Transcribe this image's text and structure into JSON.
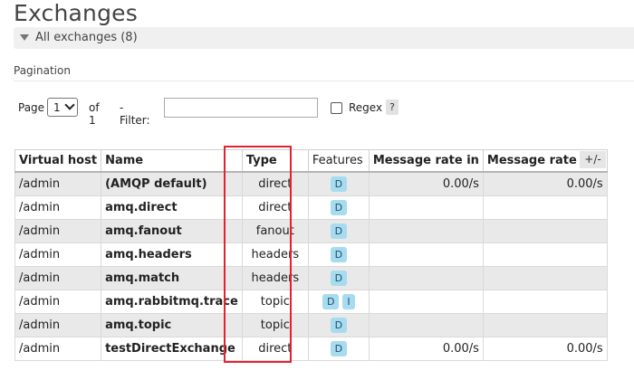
{
  "page": {
    "title": "Exchanges",
    "section_toggle_label": "All exchanges (8)"
  },
  "pagination": {
    "label": "Pagination",
    "page_label": "Page",
    "page_value": "1",
    "of_label": "of 1",
    "filter_label": "- Filter:",
    "filter_value": "",
    "regex_label": "Regex",
    "help_label": "?"
  },
  "table": {
    "columns": [
      "Virtual host",
      "Name",
      "Type",
      "Features",
      "Message rate in",
      "Message rate out"
    ],
    "toggle_columns_label": "+/-",
    "rows": [
      {
        "vhost": "/admin",
        "name": "(AMQP default)",
        "type": "direct",
        "features": [
          "D"
        ],
        "rate_in": "0.00/s",
        "rate_out": "0.00/s"
      },
      {
        "vhost": "/admin",
        "name": "amq.direct",
        "type": "direct",
        "features": [
          "D"
        ],
        "rate_in": "",
        "rate_out": ""
      },
      {
        "vhost": "/admin",
        "name": "amq.fanout",
        "type": "fanout",
        "features": [
          "D"
        ],
        "rate_in": "",
        "rate_out": ""
      },
      {
        "vhost": "/admin",
        "name": "amq.headers",
        "type": "headers",
        "features": [
          "D"
        ],
        "rate_in": "",
        "rate_out": ""
      },
      {
        "vhost": "/admin",
        "name": "amq.match",
        "type": "headers",
        "features": [
          "D"
        ],
        "rate_in": "",
        "rate_out": ""
      },
      {
        "vhost": "/admin",
        "name": "amq.rabbitmq.trace",
        "type": "topic",
        "features": [
          "D",
          "I"
        ],
        "rate_in": "",
        "rate_out": ""
      },
      {
        "vhost": "/admin",
        "name": "amq.topic",
        "type": "topic",
        "features": [
          "D"
        ],
        "rate_in": "",
        "rate_out": ""
      },
      {
        "vhost": "/admin",
        "name": "testDirectExchange",
        "type": "direct",
        "features": [
          "D"
        ],
        "rate_in": "0.00/s",
        "rate_out": "0.00/s"
      }
    ]
  },
  "colors": {
    "highlight": "#e2222f",
    "badge_bg": "#a7dbef",
    "row_alt": "#e9e9e9"
  }
}
